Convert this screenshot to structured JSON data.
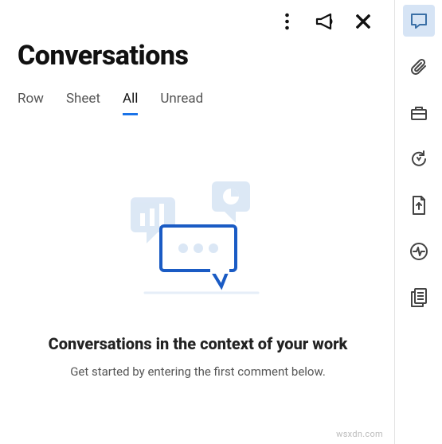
{
  "panel": {
    "title": "Conversations",
    "tabs": [
      {
        "label": "Row",
        "active": false
      },
      {
        "label": "Sheet",
        "active": false
      },
      {
        "label": "All",
        "active": true
      },
      {
        "label": "Unread",
        "active": false
      }
    ],
    "empty": {
      "heading": "Conversations in the context of your work",
      "sub": "Get started by entering the first comment below."
    },
    "header_icons": {
      "more": "more-vertical-icon",
      "announce": "megaphone-icon",
      "close": "close-icon"
    }
  },
  "rail": {
    "items": [
      {
        "name": "comments-icon",
        "active": true
      },
      {
        "name": "attachments-icon",
        "active": false
      },
      {
        "name": "briefcase-icon",
        "active": false
      },
      {
        "name": "refresh-icon",
        "active": false
      },
      {
        "name": "upload-file-icon",
        "active": false
      },
      {
        "name": "activity-icon",
        "active": false
      },
      {
        "name": "document-icon",
        "active": false
      }
    ]
  },
  "colors": {
    "accent": "#1a73e8",
    "rail_active_bg": "#d6e4f5",
    "illustration_light": "#dbe7f5",
    "illustration_dark": "#1a5bc4"
  },
  "watermark": "wsxdn.com"
}
